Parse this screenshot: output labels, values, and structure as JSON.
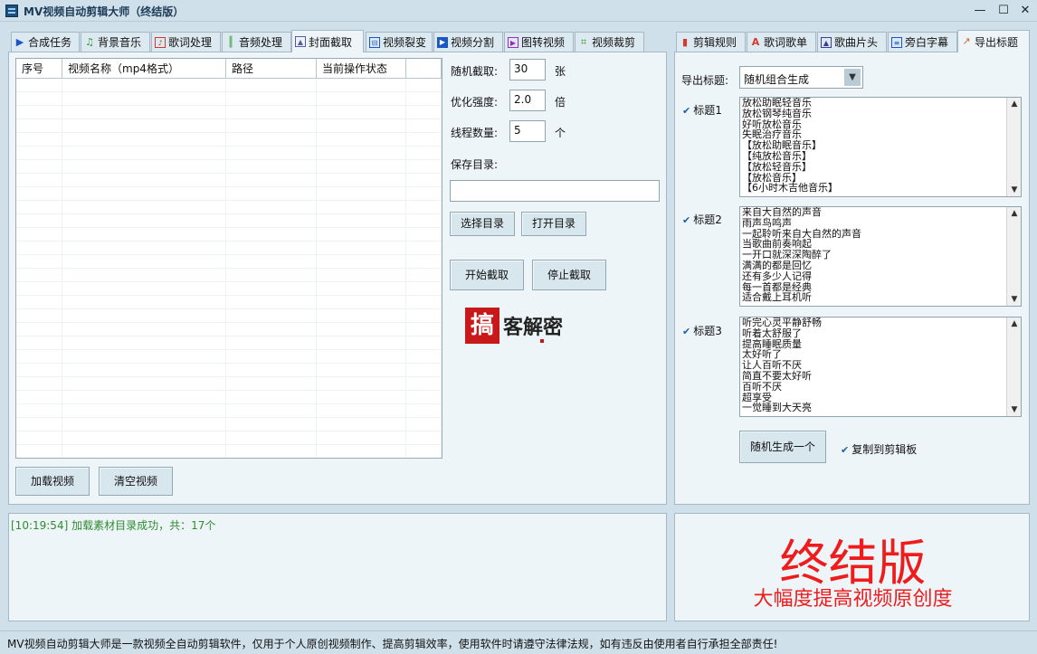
{
  "window": {
    "title": "MV视频自动剪辑大师（终结版）"
  },
  "left_tabs": [
    {
      "label": "合成任务",
      "icon": "play-icon",
      "color": "#1a56c4"
    },
    {
      "label": "背景音乐",
      "icon": "music-note-icon",
      "color": "#2b9a2b"
    },
    {
      "label": "歌词处理",
      "icon": "lyrics-icon",
      "color": "#d23b2b"
    },
    {
      "label": "音频处理",
      "icon": "waveform-icon",
      "color": "#2b9a2b"
    },
    {
      "label": "封面截取",
      "icon": "image-icon",
      "color": "#5a5aa8"
    },
    {
      "label": "视频裂变",
      "icon": "video-split-icon",
      "color": "#1a56c4"
    },
    {
      "label": "视频分割",
      "icon": "video-cut-icon",
      "color": "#1a56c4"
    },
    {
      "label": "图转视频",
      "icon": "image-to-video-icon",
      "color": "#9a2bbf"
    },
    {
      "label": "视频裁剪",
      "icon": "crop-icon",
      "color": "#2b9a2b"
    }
  ],
  "right_tabs": [
    {
      "label": "剪辑规则",
      "icon": "film-icon",
      "color": "#d23b2b"
    },
    {
      "label": "歌词歌单",
      "icon": "text-icon",
      "color": "#d23b2b"
    },
    {
      "label": "歌曲片头",
      "icon": "picture-icon",
      "color": "#3b3b9a"
    },
    {
      "label": "旁白字幕",
      "icon": "document-icon",
      "color": "#1a56c4"
    },
    {
      "label": "导出标题",
      "icon": "export-icon",
      "color": "#d2622b"
    }
  ],
  "grid": {
    "columns": [
      "序号",
      "视频名称（mp4格式）",
      "路径",
      "当前操作状态"
    ]
  },
  "settings": {
    "count_label": "随机截取:",
    "count_value": "30",
    "count_unit": "张",
    "strength_label": "优化强度:",
    "strength_value": "2.0",
    "strength_unit": "倍",
    "threads_label": "线程数量:",
    "threads_value": "5",
    "threads_unit": "个",
    "save_dir_label": "保存目录:",
    "save_dir_value": "",
    "select_dir": "选择目录",
    "open_dir": "打开目录",
    "start": "开始截取",
    "stop": "停止截取"
  },
  "watermark": {
    "text": "客解密",
    "badge": "搞"
  },
  "buttons": {
    "load": "加载视频",
    "clear": "清空视频"
  },
  "export": {
    "title_label": "导出标题:",
    "mode_value": "随机组合生成",
    "title1_label": "标题1",
    "title1_lines": [
      "放松助眠轻音乐",
      "放松钢琴纯音乐",
      "好听放松音乐",
      "失眠治疗音乐",
      "【放松助眠音乐】",
      "【纯放松音乐】",
      "【放松轻音乐】",
      "【放松音乐】",
      "【6小时木吉他音乐】"
    ],
    "title2_label": "标题2",
    "title2_lines": [
      "来自大自然的声音",
      "雨声鸟鸣声",
      "一起聆听来自大自然的声音",
      "当歌曲前奏响起",
      "一开口就深深陶醉了",
      "满满的都是回忆",
      "还有多少人记得",
      "每一首都是经典",
      "适合戴上耳机听"
    ],
    "title3_label": "标题3",
    "title3_lines": [
      "听完心灵平静舒畅",
      "听着太舒服了",
      "提高睡眠质量",
      "太好听了",
      "让人百听不厌",
      "简直不要太好听",
      "百听不厌",
      "超享受",
      "一觉睡到大天亮"
    ],
    "generate": "随机生成一个",
    "copy_label": "复制到剪辑板"
  },
  "log": {
    "line": "[10:19:54] 加载素材目录成功，共：17个"
  },
  "promo": {
    "big": "终结版",
    "sub": "大幅度提高视频原创度"
  },
  "status": {
    "text": "MV视频自动剪辑大师是一款视频全自动剪辑软件，仅用于个人原创视频制作、提高剪辑效率，使用软件时请遵守法律法规，如有违反由使用者自行承担全部责任!"
  }
}
